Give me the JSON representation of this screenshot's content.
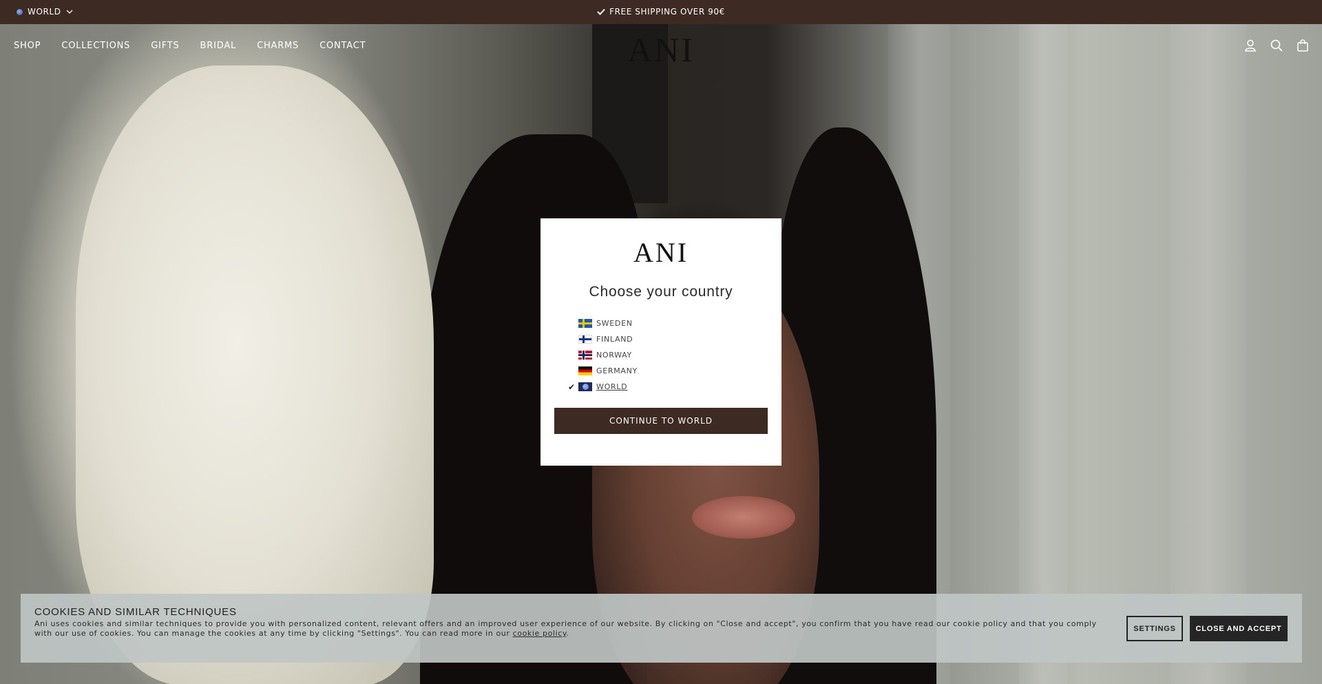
{
  "topbar": {
    "region_label": "WORLD",
    "shipping_text": "FREE SHIPPING OVER 90€"
  },
  "nav": {
    "links": [
      "SHOP",
      "COLLECTIONS",
      "GIFTS",
      "BRIDAL",
      "CHARMS",
      "CONTACT"
    ],
    "logo": "ANI",
    "icons": [
      "account-icon",
      "search-icon",
      "bag-icon"
    ]
  },
  "modal": {
    "logo": "ANI",
    "title": "Choose your country",
    "countries": [
      {
        "name": "SWEDEN",
        "flag": "se",
        "selected": false
      },
      {
        "name": "FINLAND",
        "flag": "fi",
        "selected": false
      },
      {
        "name": "NORWAY",
        "flag": "no",
        "selected": false
      },
      {
        "name": "GERMANY",
        "flag": "de",
        "selected": false
      },
      {
        "name": "WORLD",
        "flag": "world",
        "selected": true
      }
    ],
    "continue_label": "CONTINUE TO WORLD"
  },
  "cookie": {
    "title": "COOKIES AND SIMILAR TECHNIQUES",
    "text_before": "Ani uses cookies and similar techniques to provide you with personalized content, relevant offers and an improved user experience of our website. By clicking on \"Close and accept\", you confirm that you have read our cookie policy and that you comply with our use of cookies. You can manage the cookies at any time by clicking \"Settings\". You can read more in our ",
    "link_text": "cookie policy",
    "text_after": ".",
    "settings_label": "SETTINGS",
    "accept_label": "CLOSE AND ACCEPT"
  },
  "colors": {
    "brand_dark": "#3d2a22",
    "modal_bg": "#ffffff",
    "cookie_bg": "#bfc6c4",
    "accept_bg": "#252525"
  }
}
